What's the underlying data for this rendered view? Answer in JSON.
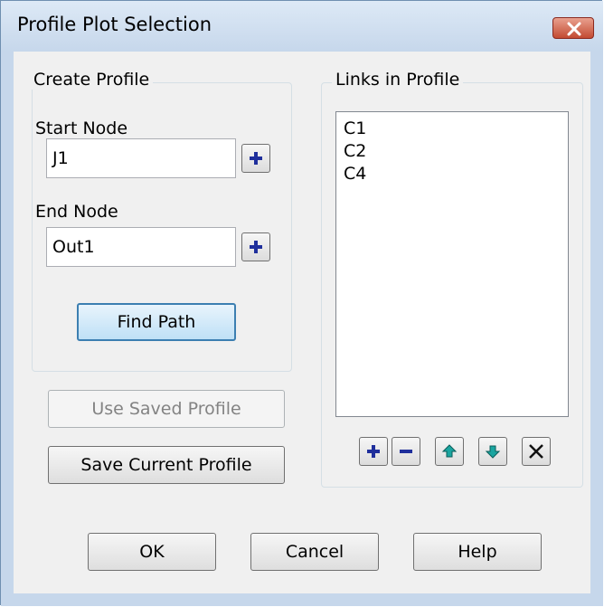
{
  "window": {
    "title": "Profile Plot Selection",
    "close_icon": "close-icon"
  },
  "create_profile": {
    "group_label": "Create Profile",
    "start_node_label": "Start Node",
    "start_node_value": "J1",
    "end_node_label": "End Node",
    "end_node_value": "Out1",
    "find_path_label": "Find Path",
    "add_icon": "plus-icon"
  },
  "profile_buttons": {
    "use_saved_label": "Use Saved Profile",
    "save_current_label": "Save Current Profile"
  },
  "links": {
    "group_label": "Links in Profile",
    "items": [
      "C1",
      "C2",
      "C4"
    ],
    "toolbar_icons": [
      "plus-icon",
      "minus-icon",
      "arrow-up-icon",
      "arrow-down-icon",
      "delete-x-icon"
    ]
  },
  "footer": {
    "ok_label": "OK",
    "cancel_label": "Cancel",
    "help_label": "Help"
  },
  "colors": {
    "accent_blue": "#1f2f9c",
    "teal_arrow": "#1aa5a0",
    "close_red": "#c34a32"
  }
}
